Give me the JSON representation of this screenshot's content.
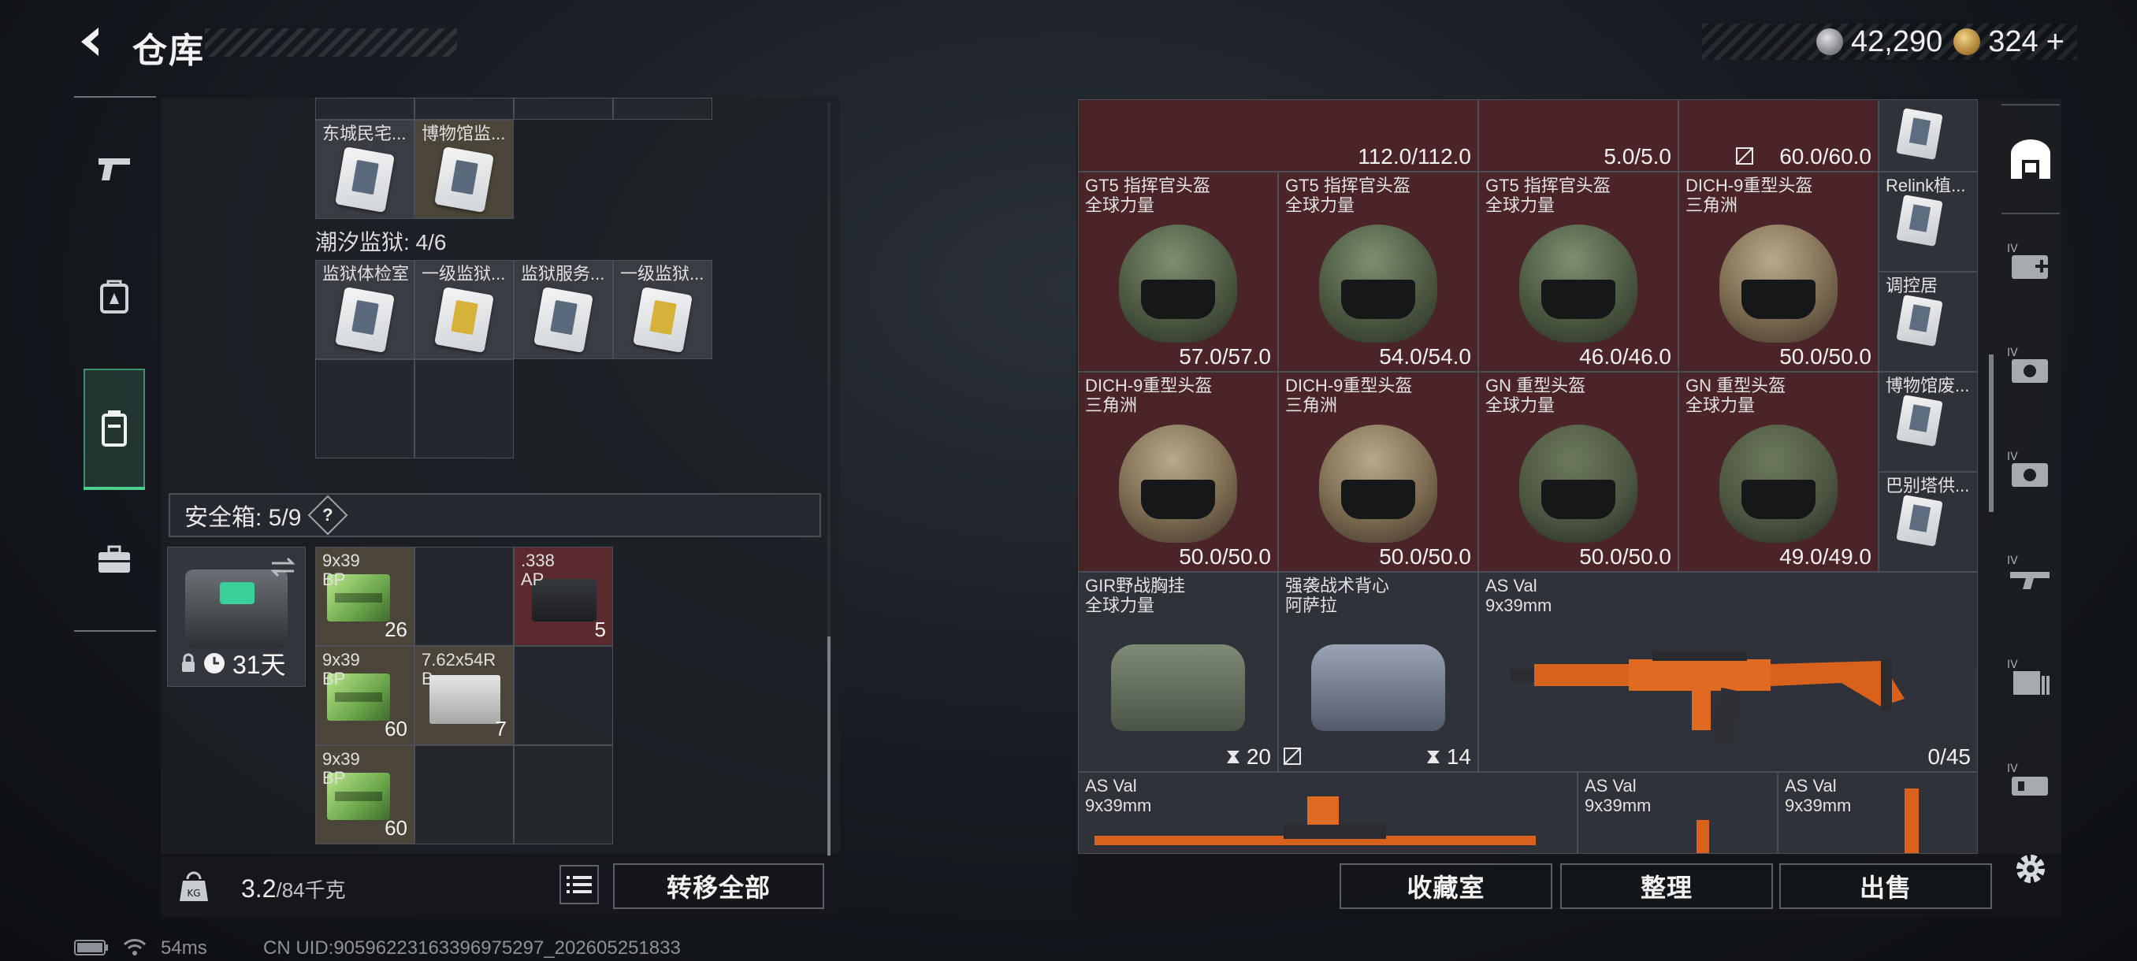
{
  "header": {
    "title": "仓库",
    "currency_silver": "42,290",
    "currency_gold": "324",
    "plus": "+"
  },
  "left_nav": {
    "items": [
      {
        "name": "weapons",
        "icon": "pistol-icon"
      },
      {
        "name": "equipment",
        "icon": "backpack-icon"
      },
      {
        "name": "storage",
        "icon": "container-icon",
        "active": true
      },
      {
        "name": "toolbox",
        "icon": "briefcase-icon"
      }
    ]
  },
  "left_panel": {
    "row_top_items": [
      {
        "label": "东城民宅...",
        "variant": "white"
      },
      {
        "label": "博物馆监...",
        "variant": "white"
      }
    ],
    "prison_title": "潮汐监狱: 4/6",
    "prison_items": [
      {
        "label": "监狱体检室",
        "variant": "white"
      },
      {
        "label": "一级监狱...",
        "variant": "yellow"
      },
      {
        "label": "监狱服务...",
        "variant": "white"
      },
      {
        "label": "一级监狱...",
        "variant": "yellow"
      }
    ],
    "safebox": {
      "label": "安全箱: 5/9",
      "help": "?",
      "days": "31天"
    },
    "ammo_items": [
      {
        "label1": "9x39",
        "label2": "BP",
        "count": "26",
        "type": "green"
      },
      {
        "label1": ".338",
        "label2": "AP",
        "count": "5",
        "type": "dark"
      },
      {
        "label1": "9x39",
        "label2": "BP",
        "count": "60",
        "type": "green"
      },
      {
        "label1": "7.62x54R",
        "label2": "B",
        "count": "7",
        "type": "white"
      },
      {
        "label1": "9x39",
        "label2": "BP",
        "count": "60",
        "type": "green"
      }
    ],
    "weight": "3.2",
    "weight_max": "/84千克",
    "transfer_all": "转移全部"
  },
  "right_panel": {
    "top_row": [
      {
        "durability": "112.0/112.0"
      },
      {
        "durability": "5.0/5.0"
      },
      {
        "durability": "60.0/60.0"
      }
    ],
    "helmets_row1": [
      {
        "name": "GT5 指挥官头盔",
        "origin": "全球力量",
        "durability": "57.0/57.0",
        "style": "olive-green"
      },
      {
        "name": "GT5 指挥官头盔",
        "origin": "全球力量",
        "durability": "54.0/54.0",
        "style": "olive-green"
      },
      {
        "name": "GT5 指挥官头盔",
        "origin": "全球力量",
        "durability": "46.0/46.0",
        "style": "olive-green"
      },
      {
        "name": "DICH-9重型头盔",
        "origin": "三角洲",
        "durability": "50.0/50.0",
        "style": "tan"
      }
    ],
    "helmets_row2": [
      {
        "name": "DICH-9重型头盔",
        "origin": "三角洲",
        "durability": "50.0/50.0",
        "style": "tan"
      },
      {
        "name": "DICH-9重型头盔",
        "origin": "三角洲",
        "durability": "50.0/50.0",
        "style": "tan"
      },
      {
        "name": "GN 重型头盔",
        "origin": "全球力量",
        "durability": "50.0/50.0",
        "style": "olive"
      },
      {
        "name": "GN 重型头盔",
        "origin": "全球力量",
        "durability": "49.0/49.0",
        "style": "olive"
      }
    ],
    "side_cards": [
      {
        "label": "Relink植..."
      },
      {
        "label": "调控居"
      },
      {
        "label": "博物馆废..."
      },
      {
        "label": "巴别塔供..."
      }
    ],
    "vests": [
      {
        "name": "GIR野战胸挂",
        "origin": "全球力量",
        "count": "20",
        "color": "green"
      },
      {
        "name": "强袭战术背心",
        "origin": "阿萨拉",
        "count": "14",
        "color": "blue"
      }
    ],
    "main_weapon": {
      "name": "AS Val",
      "caliber": "9x39mm",
      "ammo": "0/45"
    },
    "bottom_weapons": [
      {
        "name": "AS Val",
        "caliber": "9x39mm"
      },
      {
        "name": "AS Val",
        "caliber": "9x39mm"
      },
      {
        "name": "AS Val",
        "caliber": "9x39mm"
      }
    ],
    "buttons": {
      "collection": "收藏室",
      "organize": "整理",
      "sell": "出售"
    }
  },
  "status_bar": {
    "ping": "54ms",
    "uid": "CN UID:9059622316339697529​7_202605251833"
  },
  "colors": {
    "accent_green": "#4ad18f",
    "item_red": "#4b2428",
    "panel": "#1e2126"
  }
}
